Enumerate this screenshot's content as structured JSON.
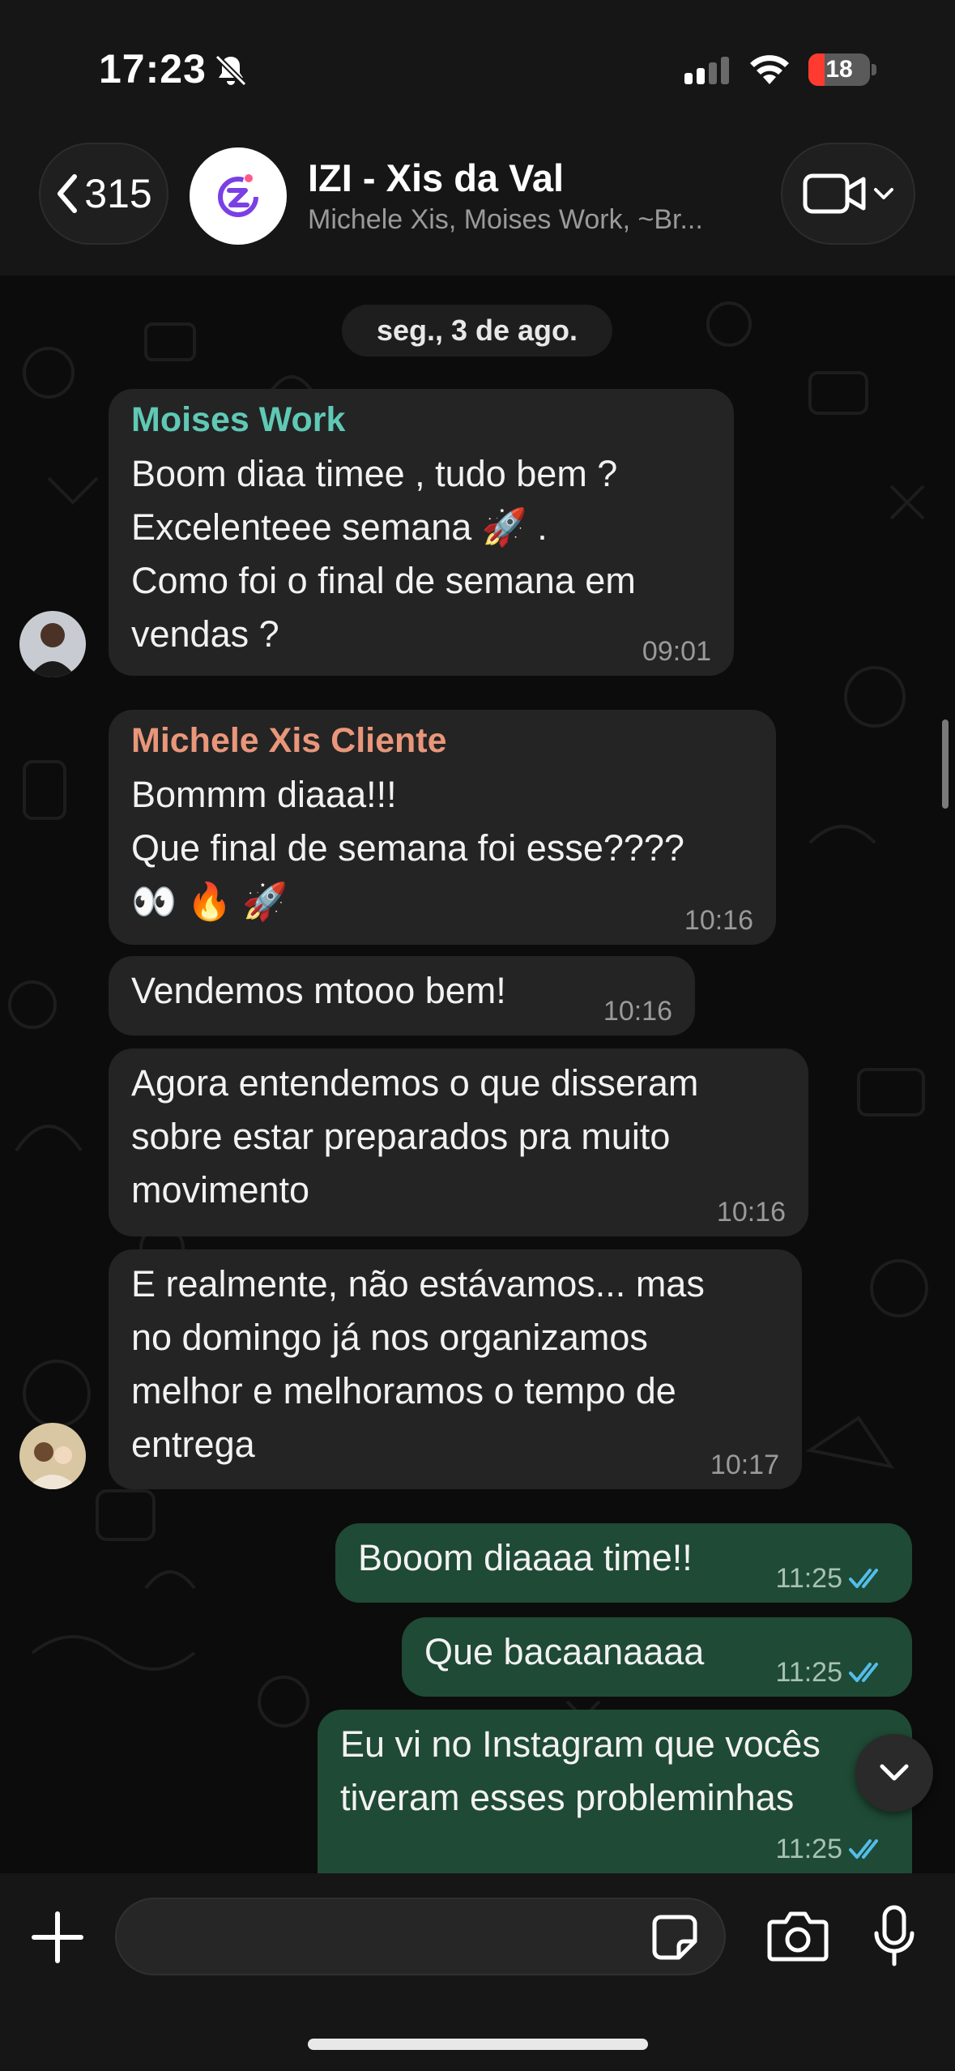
{
  "status_bar": {
    "time": "17:23",
    "battery": "18"
  },
  "header": {
    "back_count": "315",
    "title": "IZI - Xis da Val",
    "subtitle": "Michele Xis, Moises Work, ~Br..."
  },
  "chat": {
    "date": "seg., 3 de ago.",
    "messages": [
      {
        "sender": "Moises Work",
        "text": "Boom diaa timee , tudo bem ?\nExcelenteee semana 🚀 .\nComo foi o final de semana em\nvendas ?",
        "time": "09:01"
      },
      {
        "sender": "Michele Xis Cliente",
        "text": "Bommm diaaa!!!\nQue final de semana foi esse????\n👀 🔥 🚀",
        "time": "10:16"
      },
      {
        "text": "Vendemos mtooo bem!",
        "time": "10:16"
      },
      {
        "text": "Agora entendemos o que disseram\nsobre estar preparados pra muito\nmovimento",
        "time": "10:16"
      },
      {
        "text": "E realmente, não estávamos... mas\nno domingo já nos organizamos\nmelhor e melhoramos o tempo de\nentrega",
        "time": "10:17"
      },
      {
        "text": "Booom diaaaa time!!",
        "time": "11:25"
      },
      {
        "text": "Que bacaanaaaa",
        "time": "11:25"
      },
      {
        "text": "Eu vi no Instagram que vocês\ntiveram esses probleminhas",
        "time": "11:25"
      }
    ]
  },
  "composer": {
    "value": "",
    "placeholder": ""
  },
  "colors": {
    "moises_name": "#5fc9b5",
    "michele_name": "#e9967a",
    "incoming_bubble": "#242424",
    "outgoing_bubble": "#1f4a35",
    "read_ticks": "#53bdeb"
  },
  "icons": [
    "bell-slash-icon",
    "signal-icon",
    "wifi-icon",
    "battery-icon",
    "chevron-left-icon",
    "video-camera-icon",
    "chevron-down-icon",
    "plus-icon",
    "sticker-icon",
    "camera-icon",
    "microphone-icon",
    "double-check-icon"
  ]
}
